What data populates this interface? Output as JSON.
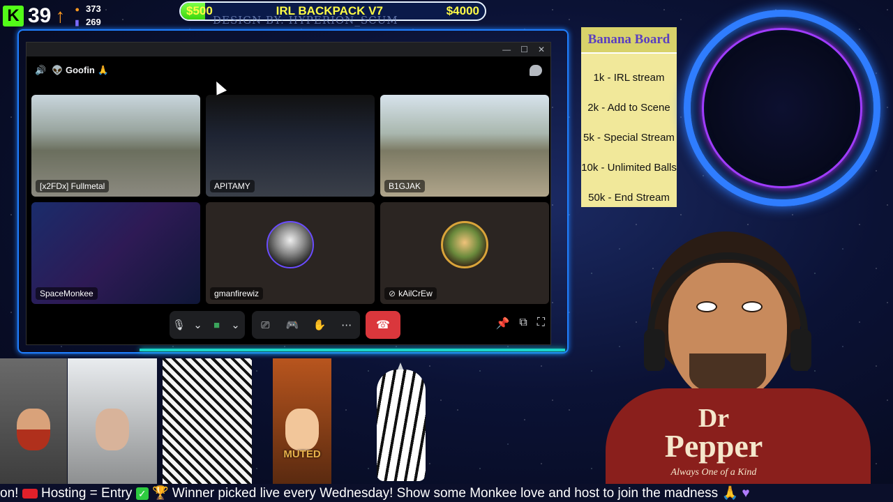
{
  "stats": {
    "viewers": "39",
    "followers": "373",
    "subs": "269"
  },
  "goal": {
    "start": "$500",
    "title": "IRL BACKPACK V7",
    "end": "$4000",
    "progress": 0.08
  },
  "design_credit": "DESIGN BY: HYPERION_SCUM",
  "discord": {
    "channel": "Goofin",
    "participants": [
      {
        "name": "[x2FDx] Fullmetal"
      },
      {
        "name": "APITAMY"
      },
      {
        "name": "B1GJAK"
      },
      {
        "name": "SpaceMonkee"
      },
      {
        "name": "gmanfirewiz"
      },
      {
        "name": "kAilCrEw"
      }
    ]
  },
  "banana_board": {
    "title": "Banana Board",
    "items": [
      "1k - IRL stream",
      "2k - Add to Scene",
      "5k - Special Stream",
      "10k - Unlimited Balls",
      "50k - End Stream"
    ]
  },
  "shirt": {
    "line1": "Dr",
    "line2": "Pepper",
    "tagline": "Always One of a Kind"
  },
  "cam_muted_label": "MUTED",
  "ticker": {
    "t1": "on!",
    "t2": "Hosting = Entry",
    "t3": "Winner picked live every Wednesday! Show some Monkee love and host to join the madness"
  },
  "colors": {
    "accent": "#1f7fff",
    "goal_fill": "#53fc18",
    "hangup": "#da373c",
    "banana_bg": "#f1e89a"
  }
}
